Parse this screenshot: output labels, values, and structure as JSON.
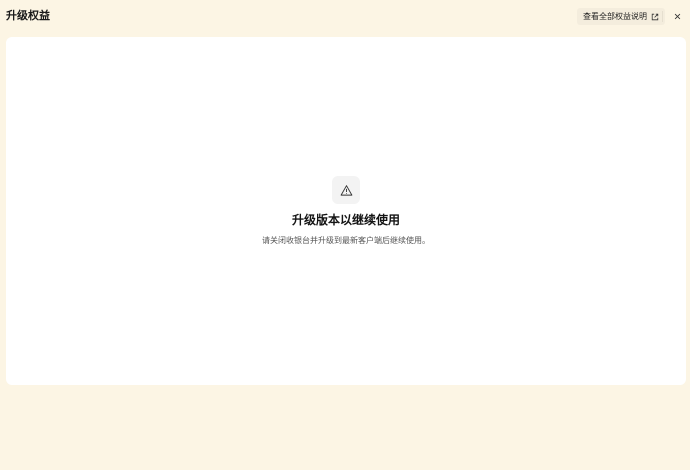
{
  "header": {
    "title": "升级权益",
    "view_rights_label": "查看全部权益说明",
    "view_rights_icon": "external-link-icon",
    "close_icon": "close-icon"
  },
  "notice": {
    "icon": "warning-icon",
    "headline": "升级版本以继续使用",
    "description": "请关闭收银台并升级到最新客户端后继续使用。"
  },
  "colors": {
    "background": "#fcf5e4",
    "card": "#ffffff",
    "button_bg": "#f4eddd"
  }
}
